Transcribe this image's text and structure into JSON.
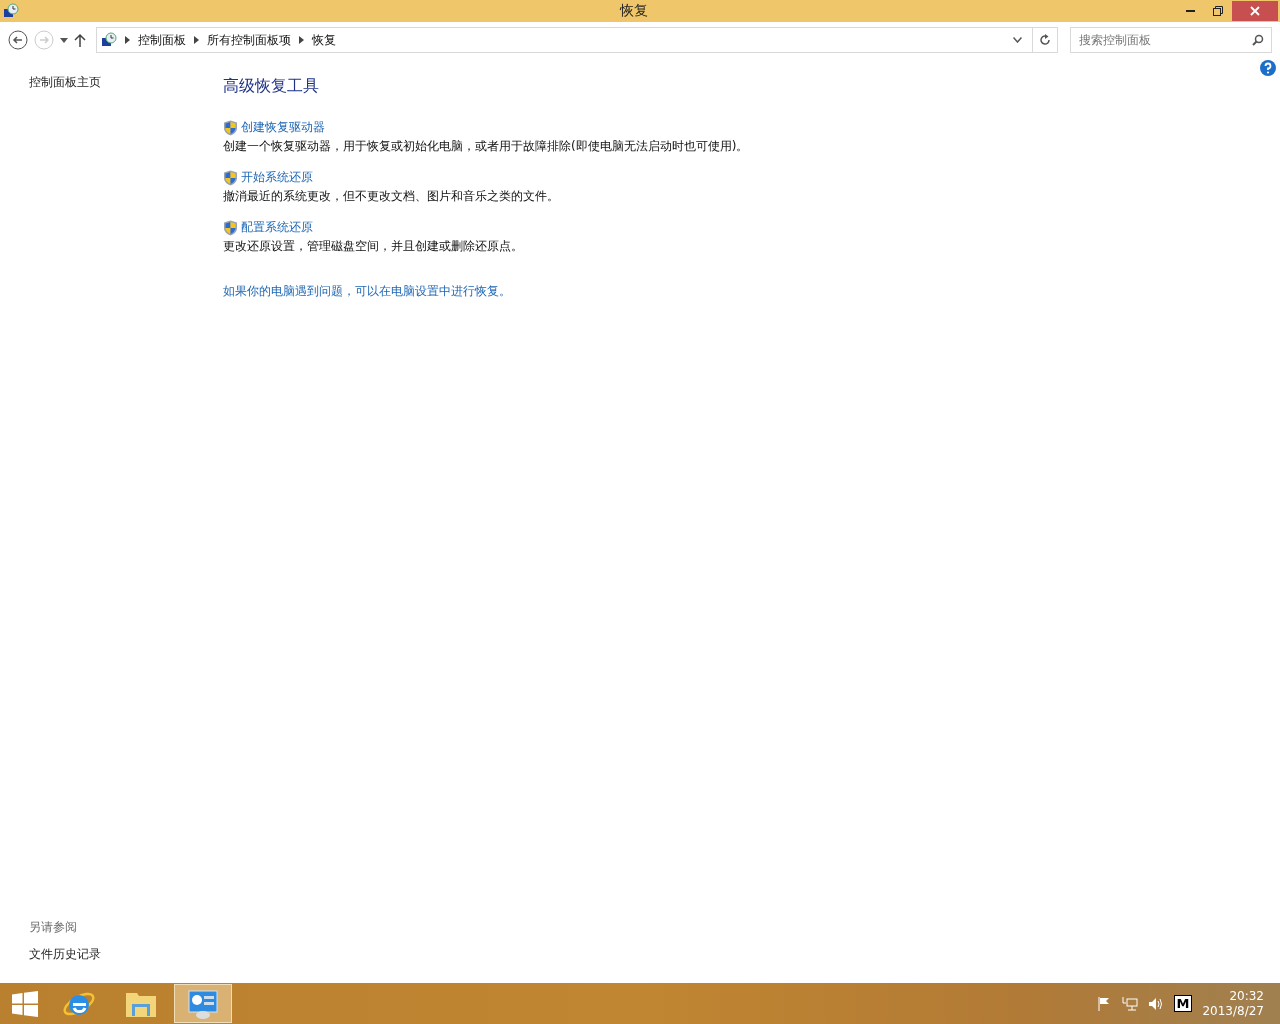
{
  "window": {
    "title": "恢复"
  },
  "address_bar": {
    "crumbs": [
      "控制面板",
      "所有控制面板项",
      "恢复"
    ]
  },
  "search": {
    "placeholder": "搜索控制面板"
  },
  "sidebar": {
    "home_link": "控制面板主页",
    "see_also_heading": "另请参阅",
    "see_also_links": [
      "文件历史记录"
    ]
  },
  "content": {
    "heading": "高级恢复工具",
    "tools": [
      {
        "title": "创建恢复驱动器",
        "description": "创建一个恢复驱动器，用于恢复或初始化电脑，或者用于故障排除(即使电脑无法启动时也可使用)。"
      },
      {
        "title": "开始系统还原",
        "description": "撤消最近的系统更改，但不更改文档、图片和音乐之类的文件。"
      },
      {
        "title": "配置系统还原",
        "description": "更改还原设置，管理磁盘空间，并且创建或删除还原点。"
      }
    ],
    "footer_link": "如果你的电脑遇到问题，可以在电脑设置中进行恢复。"
  },
  "taskbar": {
    "apps": [
      {
        "kind": "ie",
        "selected": false
      },
      {
        "kind": "explorer",
        "selected": false
      },
      {
        "kind": "control-panel",
        "selected": true
      }
    ],
    "clock": {
      "time": "20:32",
      "date": "2013/8/27"
    },
    "tray_letter": "M"
  }
}
